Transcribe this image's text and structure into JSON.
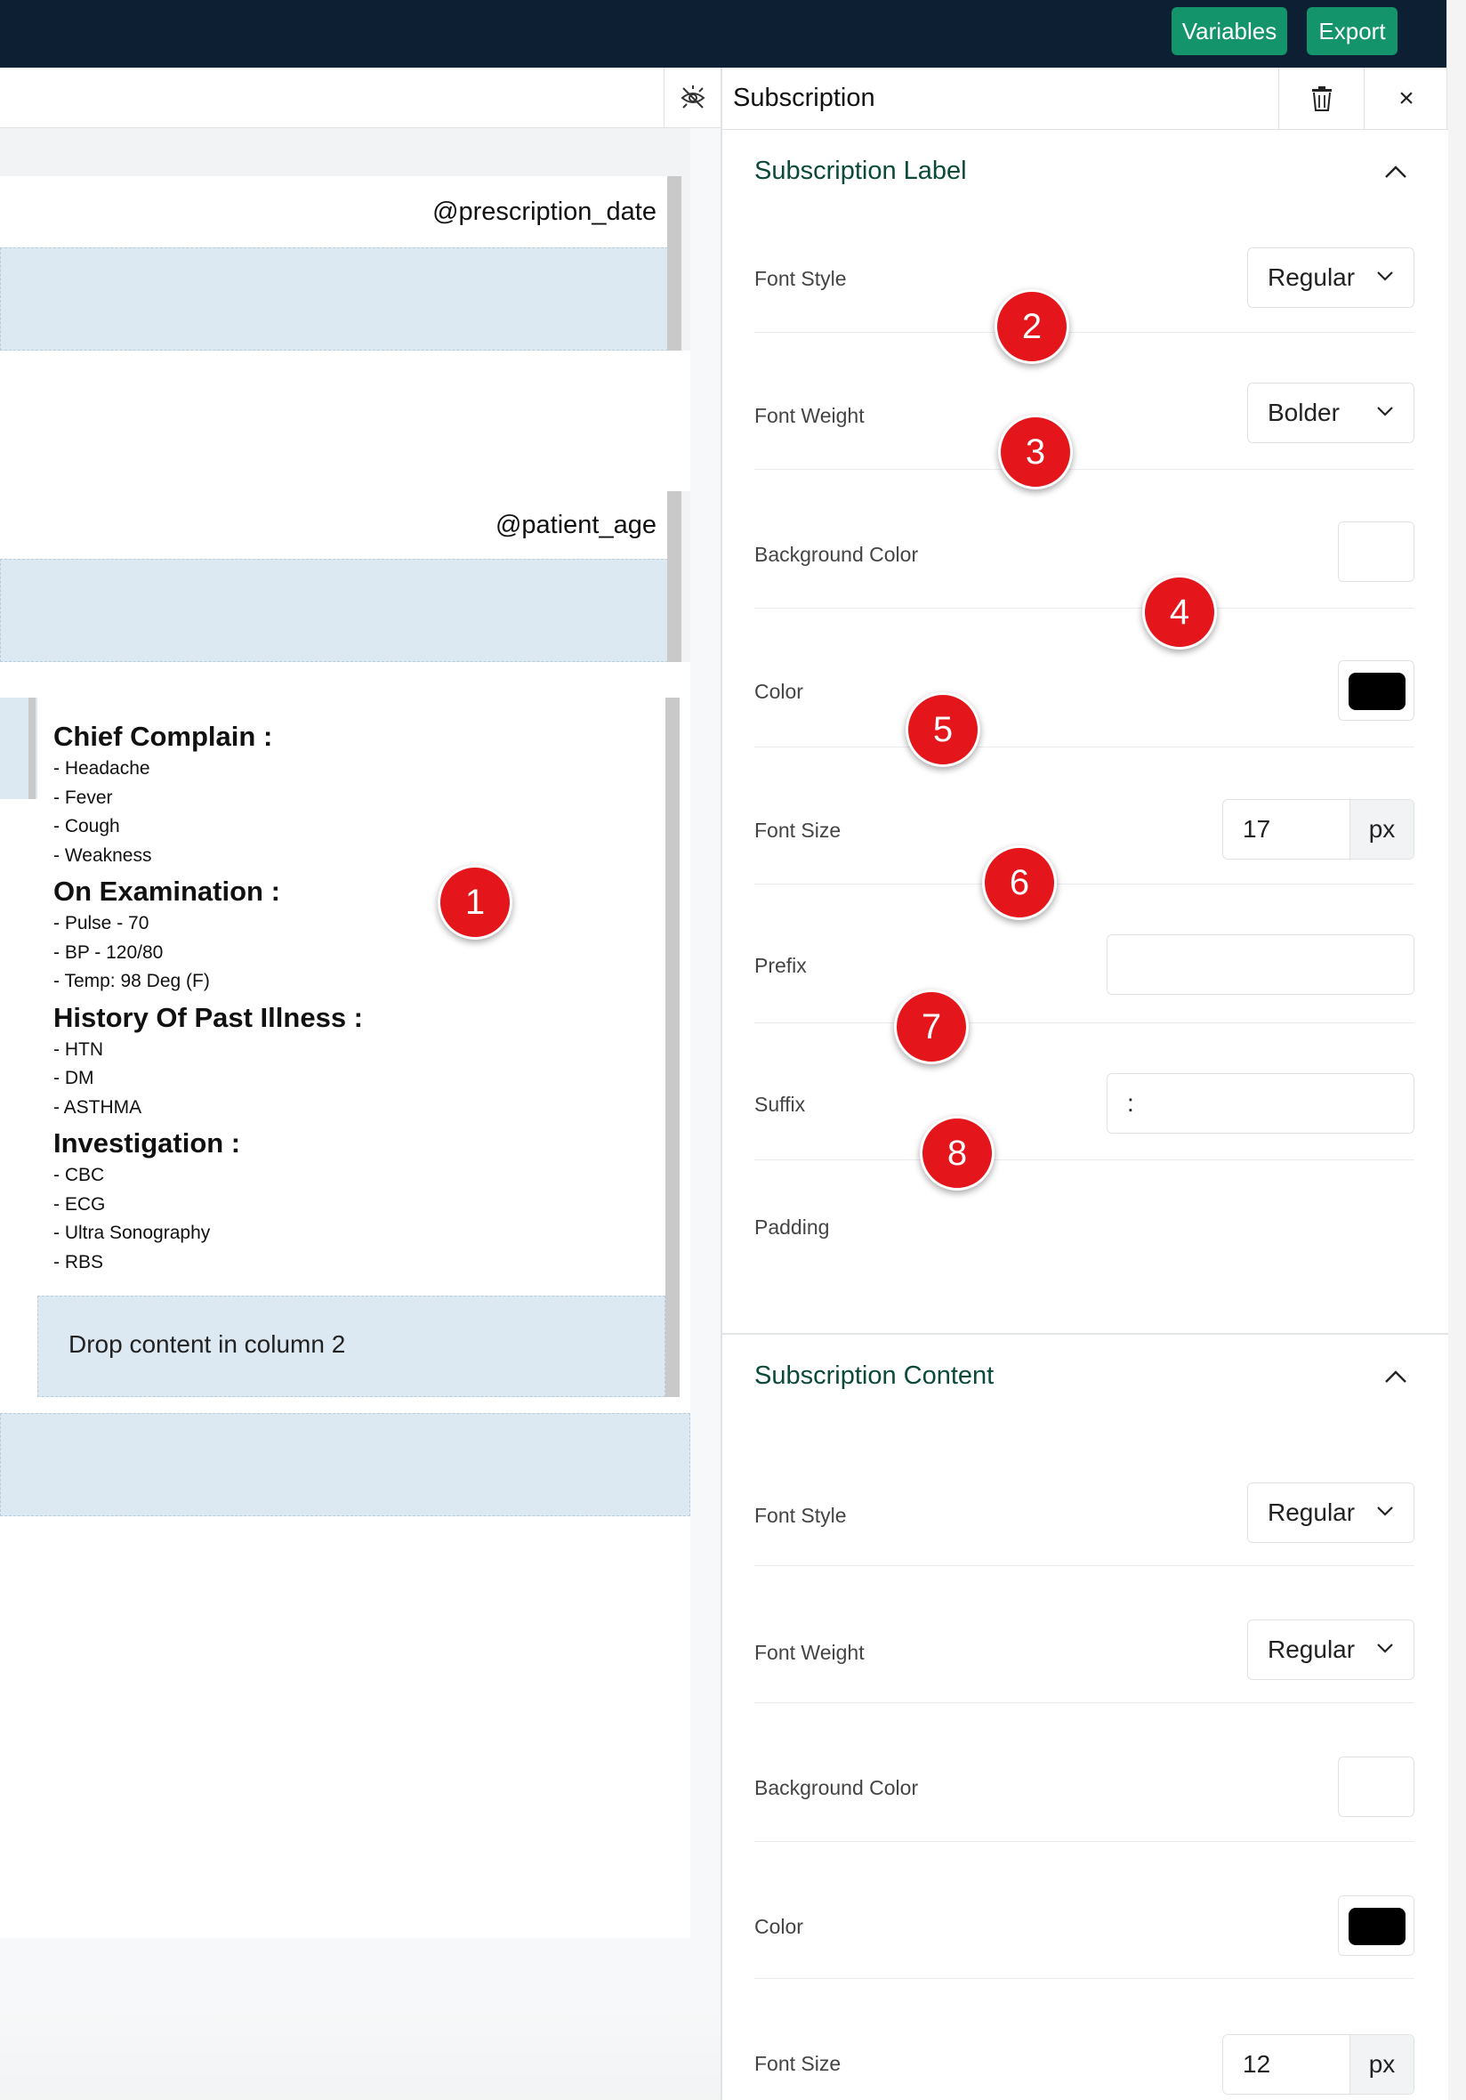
{
  "topbar": {
    "variables_label": "Variables",
    "export_label": "Export"
  },
  "canvas": {
    "prescription_date": "@prescription_date",
    "patient_age": "@patient_age",
    "sections": [
      {
        "title": "Chief Complain :",
        "items": [
          "- Headache",
          "- Fever",
          "- Cough",
          "- Weakness"
        ]
      },
      {
        "title": "On Examination :",
        "items": [
          "- Pulse - 70",
          "- BP - 120/80",
          "- Temp: 98 Deg (F)"
        ]
      },
      {
        "title": "History Of Past Illness :",
        "items": [
          "- HTN",
          "- DM",
          "- ASTHMA"
        ]
      },
      {
        "title": "Investigation :",
        "items": [
          "- CBC",
          "- ECG",
          "- Ultra Sonography",
          "- RBS"
        ]
      }
    ],
    "drop_column_2": "Drop content in column 2"
  },
  "panel": {
    "title": "Subscription",
    "label_section": {
      "heading": "Subscription Label",
      "font_style_label": "Font Style",
      "font_style_value": "Regular",
      "font_weight_label": "Font Weight",
      "font_weight_value": "Bolder",
      "background_color_label": "Background Color",
      "color_label": "Color",
      "font_size_label": "Font Size",
      "font_size_value": "17",
      "font_size_unit": "px",
      "prefix_label": "Prefix",
      "prefix_value": "",
      "suffix_label": "Suffix",
      "suffix_value": ":",
      "padding_label": "Padding"
    },
    "content_section": {
      "heading": "Subscription Content",
      "font_style_label": "Font Style",
      "font_style_value": "Regular",
      "font_weight_label": "Font Weight",
      "font_weight_value": "Regular",
      "background_color_label": "Background Color",
      "color_label": "Color",
      "font_size_label": "Font Size",
      "font_size_value": "12",
      "font_size_unit": "px"
    }
  },
  "markers": [
    "1",
    "2",
    "3",
    "4",
    "5",
    "6",
    "7",
    "8"
  ],
  "colors": {
    "topbar": "#0c1f33",
    "button_green": "#13946a",
    "section_heading": "#0b4a3a",
    "marker_red": "#e4161b",
    "drop_zone": "#dde9f2"
  }
}
